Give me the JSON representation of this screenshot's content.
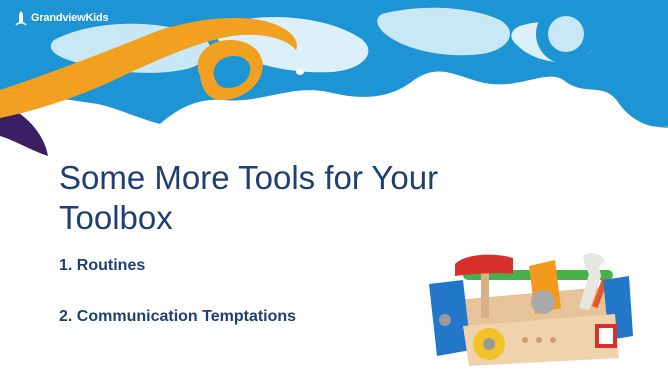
{
  "logo": {
    "text": "GrandviewKids",
    "icon": "lighthouse-icon"
  },
  "slide": {
    "title": "Some More Tools for Your Toolbox",
    "bullets": [
      "1. Routines",
      "2. Communication Temptations"
    ]
  },
  "toolbox_image": {
    "icon": "toy-toolbox-image"
  },
  "colors": {
    "banner_blue": "#1d95d5",
    "banner_light": "#c9e8f6",
    "banner_orange": "#f2a01f",
    "banner_purple": "#3b1f63",
    "title_text": "#1f3e73"
  }
}
